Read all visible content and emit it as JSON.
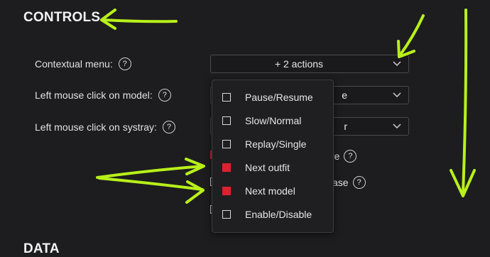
{
  "section_title": "CONTROLS",
  "next_section_title": "DATA",
  "rows": [
    {
      "label": "Contextual menu:",
      "help": "?",
      "value": "+ 2 actions"
    },
    {
      "label": "Left mouse click on model:",
      "help": "?",
      "value": "e"
    },
    {
      "label": "Left mouse click on systray:",
      "help": "?",
      "value": "r"
    }
  ],
  "checkbox_rows": [
    {
      "text": "re",
      "help": "?",
      "checked": true
    },
    {
      "text": "ase",
      "help": "?",
      "checked": false
    },
    {
      "text": "",
      "checked": false
    }
  ],
  "dropdown_menu": {
    "items": [
      {
        "label": "Pause/Resume",
        "checked": false
      },
      {
        "label": "Slow/Normal",
        "checked": false
      },
      {
        "label": "Replay/Single",
        "checked": false
      },
      {
        "label": "Next outfit",
        "checked": true
      },
      {
        "label": "Next model",
        "checked": true
      },
      {
        "label": "Enable/Disable",
        "checked": false
      }
    ]
  },
  "colors": {
    "accent": "#e0202e",
    "annotation": "#b8f01a",
    "background": "#1d1d1f"
  },
  "icons": {
    "help": "help-circle-icon",
    "chevron": "chevron-down-icon"
  }
}
